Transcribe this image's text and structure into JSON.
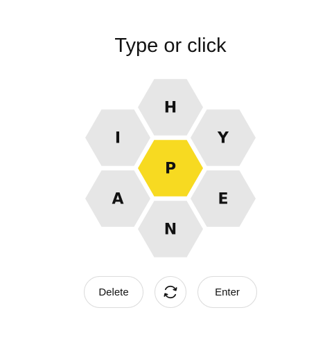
{
  "prompt": "Type or click",
  "hive": {
    "center": {
      "letter": "P",
      "color": "#f7da21"
    },
    "outer": [
      {
        "position": "top",
        "letter": "H"
      },
      {
        "position": "upper-left",
        "letter": "I"
      },
      {
        "position": "upper-right",
        "letter": "Y"
      },
      {
        "position": "lower-left",
        "letter": "A"
      },
      {
        "position": "lower-right",
        "letter": "E"
      },
      {
        "position": "bottom",
        "letter": "N"
      }
    ],
    "outer_color": "#e6e6e6"
  },
  "controls": {
    "delete_label": "Delete",
    "shuffle_icon": "shuffle-icon",
    "enter_label": "Enter"
  }
}
